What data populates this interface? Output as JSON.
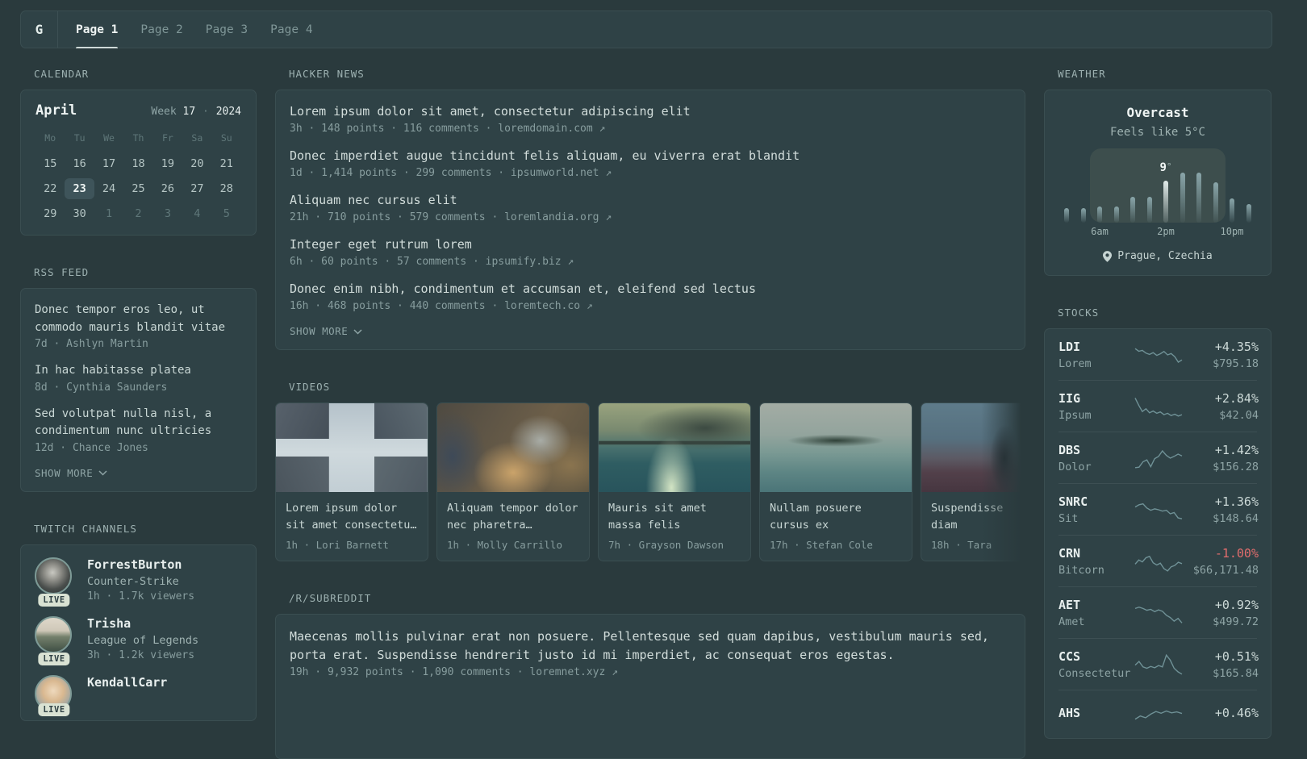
{
  "header": {
    "logo": "G",
    "active_tab": 0,
    "tabs": [
      {
        "label": "Page 1"
      },
      {
        "label": "Page 2"
      },
      {
        "label": "Page 3"
      },
      {
        "label": "Page 4"
      }
    ]
  },
  "calendar": {
    "section_title": "CALENDAR",
    "month": "April",
    "week_label": "Week",
    "week_number": "17",
    "separator": "·",
    "year": "2024",
    "weekdays": [
      "Mo",
      "Tu",
      "We",
      "Th",
      "Fr",
      "Sa",
      "Su"
    ],
    "days": [
      {
        "d": "15"
      },
      {
        "d": "16"
      },
      {
        "d": "17"
      },
      {
        "d": "18"
      },
      {
        "d": "19"
      },
      {
        "d": "20"
      },
      {
        "d": "21"
      },
      {
        "d": "22"
      },
      {
        "d": "23",
        "selected": true
      },
      {
        "d": "24"
      },
      {
        "d": "25"
      },
      {
        "d": "26"
      },
      {
        "d": "27"
      },
      {
        "d": "28"
      },
      {
        "d": "29"
      },
      {
        "d": "30"
      },
      {
        "d": "1",
        "outside": true
      },
      {
        "d": "2",
        "outside": true
      },
      {
        "d": "3",
        "outside": true
      },
      {
        "d": "4",
        "outside": true
      },
      {
        "d": "5",
        "outside": true
      }
    ]
  },
  "rss": {
    "section_title": "RSS FEED",
    "items": [
      {
        "title": "Donec tempor eros leo, ut commodo mauris blandit vitae",
        "meta": "7d · Ashlyn Martin"
      },
      {
        "title": "In hac habitasse platea",
        "meta": "8d · Cynthia Saunders"
      },
      {
        "title": "Sed volutpat nulla nisl, a condimentum nunc ultricies",
        "meta": "12d · Chance Jones"
      }
    ],
    "show_more": "SHOW MORE"
  },
  "twitch": {
    "section_title": "TWITCH CHANNELS",
    "channels": [
      {
        "name": "ForrestBurton",
        "game": "Counter-Strike",
        "meta": "1h · 1.7k viewers",
        "live": "LIVE"
      },
      {
        "name": "Trisha",
        "game": "League of Legends",
        "meta": "3h · 1.2k viewers",
        "live": "LIVE"
      },
      {
        "name": "KendallCarr",
        "game": "",
        "meta": "",
        "live": "LIVE"
      }
    ]
  },
  "hackernews": {
    "section_title": "HACKER NEWS",
    "items": [
      {
        "title": "Lorem ipsum dolor sit amet, consectetur adipiscing elit",
        "meta": "3h · 148 points · 116 comments · loremdomain.com ↗"
      },
      {
        "title": "Donec imperdiet augue tincidunt felis aliquam, eu viverra erat blandit",
        "meta": "1d · 1,414 points · 299 comments · ipsumworld.net ↗"
      },
      {
        "title": "Aliquam nec cursus elit",
        "meta": "21h · 710 points · 579 comments · loremlandia.org ↗"
      },
      {
        "title": "Integer eget rutrum lorem",
        "meta": "6h · 60 points · 57 comments · ipsumify.biz ↗"
      },
      {
        "title": "Donec enim nibh, condimentum et accumsan et, eleifend sed lectus",
        "meta": "16h · 468 points · 440 comments · loremtech.co ↗"
      }
    ],
    "show_more": "SHOW MORE"
  },
  "videos": {
    "section_title": "VIDEOS",
    "items": [
      {
        "title": "Lorem ipsum dolor sit amet consectetu…",
        "meta": "1h · Lori Barnett"
      },
      {
        "title": "Aliquam tempor dolor nec pharetra…",
        "meta": "1h · Molly Carrillo"
      },
      {
        "title": "Mauris sit amet massa felis",
        "meta": "7h · Grayson Dawson"
      },
      {
        "title": "Nullam posuere cursus ex",
        "meta": "17h · Stefan Cole"
      },
      {
        "title": "Suspendisse\ndiam",
        "meta": "18h · Tara"
      }
    ]
  },
  "subreddit": {
    "section_title": "/R/SUBREDDIT",
    "post": {
      "title": "Maecenas mollis pulvinar erat non posuere. Pellentesque sed quam dapibus, vestibulum mauris sed, porta erat. Suspendisse hendrerit justo id mi imperdiet, ac consequat eros egestas.",
      "meta": "19h · 9,932 points · 1,090 comments · loremnet.xyz ↗"
    }
  },
  "weather": {
    "section_title": "WEATHER",
    "condition": "Overcast",
    "feels_like": "Feels like 5°C",
    "current_temp": "9",
    "degree_symbol": "°",
    "hour_labels": [
      "6am",
      "2pm",
      "10pm"
    ],
    "location": "Prague, Czechia",
    "chart": {
      "type": "bar",
      "values": [
        29,
        29,
        32,
        32,
        52,
        52,
        84,
        100,
        100,
        81,
        48,
        37
      ],
      "current_index": 6,
      "daylight_range": [
        2,
        9
      ],
      "label_positions": [
        2,
        6,
        10
      ]
    }
  },
  "stocks": {
    "section_title": "STOCKS",
    "items": [
      {
        "symbol": "LDI",
        "name": "Lorem",
        "change": "+4.35%",
        "price": "$795.18",
        "negative": false,
        "spark": [
          78,
          66,
          70,
          58,
          52,
          60,
          48,
          55,
          65,
          50,
          56,
          42,
          18,
          28
        ]
      },
      {
        "symbol": "IIG",
        "name": "Ipsum",
        "change": "+2.84%",
        "price": "$42.04",
        "negative": false,
        "spark": [
          88,
          55,
          28,
          40,
          22,
          30,
          20,
          26,
          14,
          20,
          10,
          16,
          8,
          14
        ]
      },
      {
        "symbol": "DBS",
        "name": "Dolor",
        "change": "+1.42%",
        "price": "$156.28",
        "negative": false,
        "spark": [
          8,
          10,
          34,
          42,
          12,
          48,
          58,
          82,
          62,
          50,
          58,
          68,
          60
        ]
      },
      {
        "symbol": "SNRC",
        "name": "Sit",
        "change": "+1.36%",
        "price": "$148.64",
        "negative": false,
        "spark": [
          62,
          72,
          76,
          58,
          48,
          54,
          50,
          44,
          48,
          32,
          38,
          14,
          10
        ]
      },
      {
        "symbol": "CRN",
        "name": "Bitcorn",
        "change": "-1.00%",
        "price": "$66,171.48",
        "negative": true,
        "spark": [
          38,
          56,
          48,
          66,
          72,
          44,
          34,
          42,
          18,
          8,
          26,
          32,
          46,
          40
        ]
      },
      {
        "symbol": "AET",
        "name": "Amet",
        "change": "+0.92%",
        "price": "$499.72",
        "negative": false,
        "spark": [
          70,
          76,
          70,
          62,
          66,
          56,
          64,
          58,
          40,
          30,
          14,
          26,
          6
        ]
      },
      {
        "symbol": "CCS",
        "name": "Consectetur",
        "change": "+0.51%",
        "price": "$165.84",
        "negative": false,
        "spark": [
          48,
          64,
          40,
          34,
          42,
          36,
          46,
          40,
          92,
          70,
          34,
          18,
          8
        ]
      },
      {
        "symbol": "AHS",
        "name": "",
        "change": "+0.46%",
        "price": "",
        "negative": false,
        "spark": [
          30,
          44,
          36,
          52,
          64,
          56,
          66,
          58,
          62,
          55
        ]
      }
    ]
  }
}
